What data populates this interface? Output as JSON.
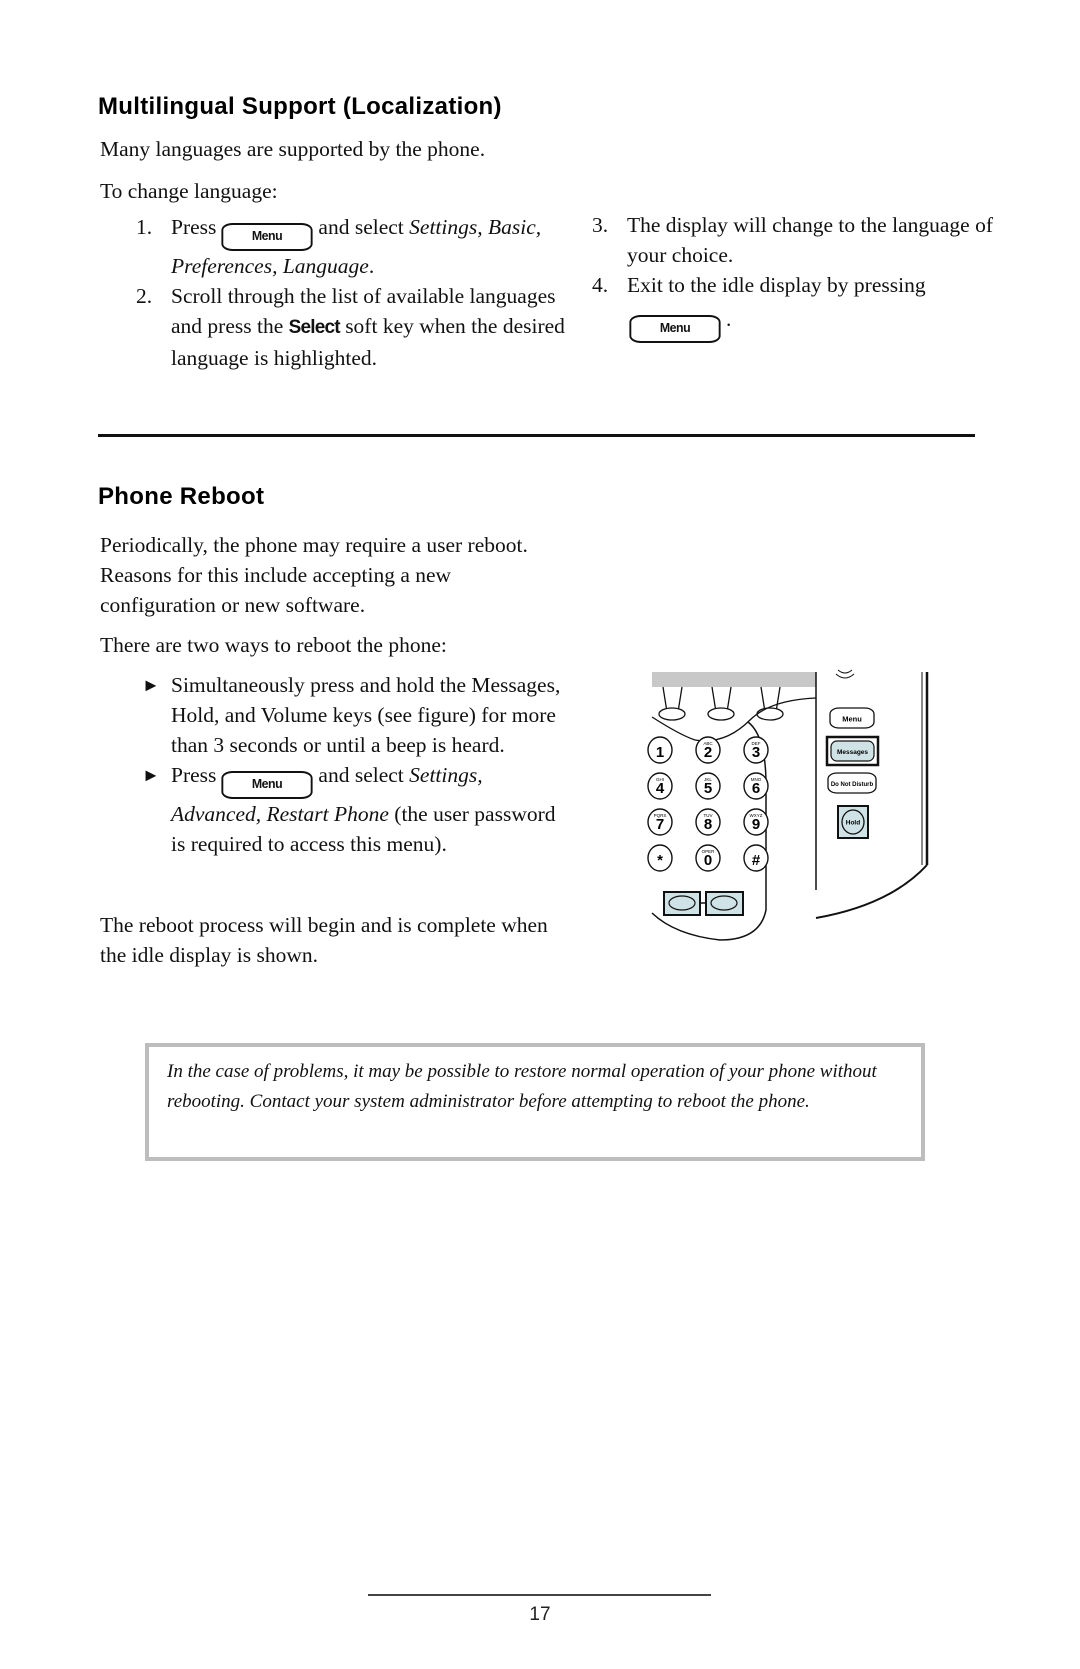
{
  "section1": {
    "heading": "Multilingual Support (Localization)",
    "intro": "Many languages are supported by the phone.",
    "lead": "To change language:",
    "steps": [
      {
        "num": "1.",
        "pre": "Press",
        "key": "Menu",
        "mid": "and select",
        "italic": "Settings, Basic, Preferences, Language",
        "post": "."
      },
      {
        "num": "2.",
        "pre": "Scroll through the list of available languages and press the",
        "softkey": "Select",
        "post": "soft key when the desired language is highlighted."
      },
      {
        "num": "3.",
        "text": "The display will change to the language of your choice."
      },
      {
        "num": "4.",
        "pre": "Exit to the idle display by pressing",
        "key": "Menu",
        "post": "."
      }
    ]
  },
  "section2": {
    "heading": "Phone Reboot",
    "intro": "Periodically, the phone may require a user reboot.  Reasons for this include accepting a new configuration or new software.",
    "lead": "There are two ways to reboot the phone:",
    "bullets": [
      {
        "icon": "triangle-bullet-icon",
        "glyph": "►",
        "text": "Simultaneously press and hold the Messages, Hold, and Volume keys (see figure) for more than 3 seconds or until a beep is heard."
      },
      {
        "icon": "triangle-bullet-icon",
        "glyph": "►",
        "pre": "Press",
        "key": "Menu",
        "mid": "and select",
        "italic": "Settings, Advanced, Restart Phone",
        "post": "(the user password is required to access this menu)."
      }
    ],
    "outro": "The reboot process will begin and is complete when the idle display is shown."
  },
  "figure": {
    "keypad": [
      {
        "digit": "1",
        "letters": ""
      },
      {
        "digit": "2",
        "letters": "ABC"
      },
      {
        "digit": "3",
        "letters": "DEF"
      },
      {
        "digit": "4",
        "letters": "GHI"
      },
      {
        "digit": "5",
        "letters": "JKL"
      },
      {
        "digit": "6",
        "letters": "MNO"
      },
      {
        "digit": "7",
        "letters": "PQRS"
      },
      {
        "digit": "8",
        "letters": "TUV"
      },
      {
        "digit": "9",
        "letters": "WXYZ"
      },
      {
        "digit": "*",
        "letters": ""
      },
      {
        "digit": "0",
        "letters": "OPER"
      },
      {
        "digit": "#",
        "letters": ""
      }
    ],
    "buttons": {
      "menu": "Menu",
      "messages": "Messages",
      "do_not_disturb": "Do Not Disturb",
      "hold": "Hold"
    },
    "highlight_color": "#cfe3e6",
    "screen_color": "#c8c8c8"
  },
  "note": {
    "text": "In the case of problems, it may be possible to restore normal operation of your phone without rebooting.  Contact your system administrator before attempting to reboot the phone."
  },
  "footer": {
    "page_number": "17"
  }
}
